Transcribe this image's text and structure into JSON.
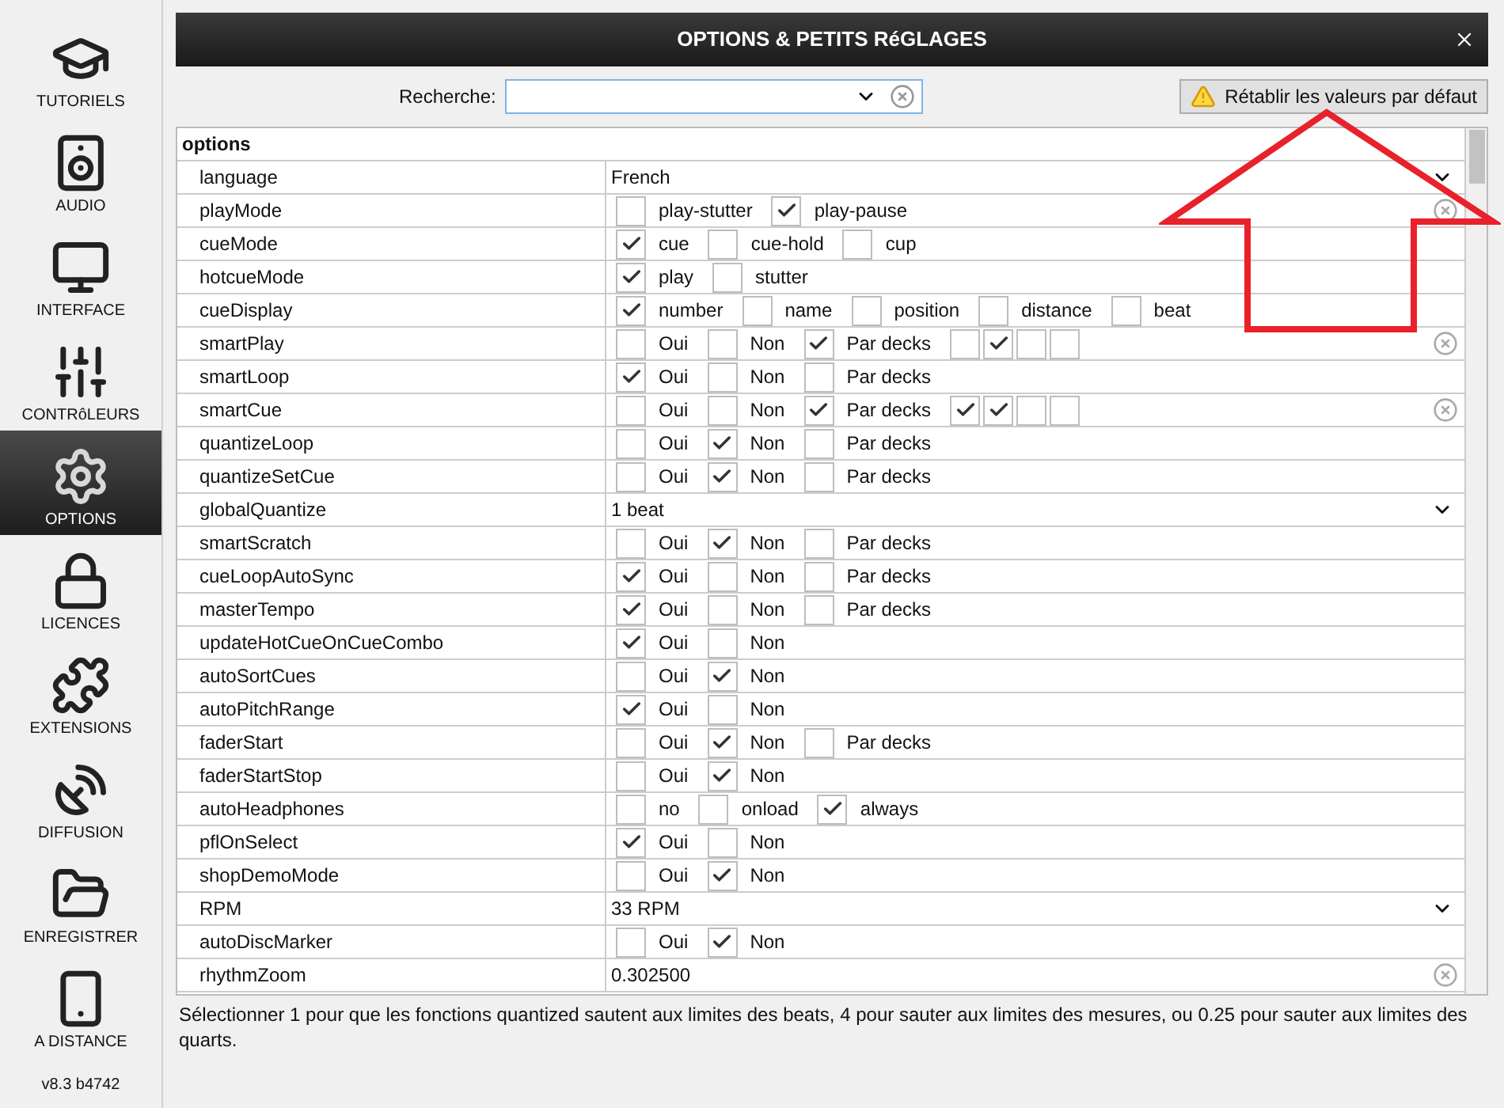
{
  "sidebar": {
    "items": [
      {
        "kind": "tutorials",
        "label": "TUTORIELS",
        "selected": false
      },
      {
        "kind": "audio",
        "label": "AUDIO",
        "selected": false
      },
      {
        "kind": "interface",
        "label": "INTERFACE",
        "selected": false
      },
      {
        "kind": "controllers",
        "label": "CONTRôLEURS",
        "selected": false
      },
      {
        "kind": "options",
        "label": "OPTIONS",
        "selected": true
      },
      {
        "kind": "licences",
        "label": "LICENCES",
        "selected": false
      },
      {
        "kind": "extensions",
        "label": "EXTENSIONS",
        "selected": false
      },
      {
        "kind": "broadcast",
        "label": "DIFFUSION",
        "selected": false
      },
      {
        "kind": "record",
        "label": "ENREGISTRER",
        "selected": false
      },
      {
        "kind": "remote",
        "label": "A DISTANCE",
        "selected": false
      }
    ],
    "version": "v8.3 b4742"
  },
  "window": {
    "title": "OPTIONS & PETITS RéGLAGES"
  },
  "search": {
    "label": "Recherche:"
  },
  "reset_button": {
    "label": "Rétablir les valeurs par défaut"
  },
  "table": {
    "section": "options",
    "rows": [
      {
        "name": "language",
        "kind": "select",
        "value": "French",
        "modified": false
      },
      {
        "name": "playMode",
        "kind": "checks",
        "modified": true,
        "options": [
          {
            "label": "play-stutter",
            "checked": false
          },
          {
            "label": "play-pause",
            "checked": true
          }
        ]
      },
      {
        "name": "cueMode",
        "kind": "checks",
        "modified": false,
        "options": [
          {
            "label": "cue",
            "checked": true
          },
          {
            "label": "cue-hold",
            "checked": false
          },
          {
            "label": "cup",
            "checked": false
          }
        ]
      },
      {
        "name": "hotcueMode",
        "kind": "checks",
        "modified": false,
        "options": [
          {
            "label": "play",
            "checked": true
          },
          {
            "label": "stutter",
            "checked": false
          }
        ]
      },
      {
        "name": "cueDisplay",
        "kind": "checks",
        "modified": false,
        "options": [
          {
            "label": "number",
            "checked": true
          },
          {
            "label": "name",
            "checked": false
          },
          {
            "label": "position",
            "checked": false
          },
          {
            "label": "distance",
            "checked": false
          },
          {
            "label": "beat",
            "checked": false
          }
        ]
      },
      {
        "name": "smartPlay",
        "kind": "checks",
        "modified": true,
        "options": [
          {
            "label": "Oui",
            "checked": false
          },
          {
            "label": "Non",
            "checked": false
          },
          {
            "label": "Par decks",
            "checked": true
          }
        ],
        "decks": [
          {
            "checked": false
          },
          {
            "checked": true
          },
          {
            "checked": false
          },
          {
            "checked": false
          }
        ]
      },
      {
        "name": "smartLoop",
        "kind": "checks",
        "modified": false,
        "options": [
          {
            "label": "Oui",
            "checked": true
          },
          {
            "label": "Non",
            "checked": false
          },
          {
            "label": "Par decks",
            "checked": false
          }
        ]
      },
      {
        "name": "smartCue",
        "kind": "checks",
        "modified": true,
        "options": [
          {
            "label": "Oui",
            "checked": false
          },
          {
            "label": "Non",
            "checked": false
          },
          {
            "label": "Par decks",
            "checked": true
          }
        ],
        "decks": [
          {
            "checked": true
          },
          {
            "checked": true
          },
          {
            "checked": false
          },
          {
            "checked": false
          }
        ]
      },
      {
        "name": "quantizeLoop",
        "kind": "checks",
        "modified": false,
        "options": [
          {
            "label": "Oui",
            "checked": false
          },
          {
            "label": "Non",
            "checked": true
          },
          {
            "label": "Par decks",
            "checked": false
          }
        ]
      },
      {
        "name": "quantizeSetCue",
        "kind": "checks",
        "modified": false,
        "options": [
          {
            "label": "Oui",
            "checked": false
          },
          {
            "label": "Non",
            "checked": true
          },
          {
            "label": "Par decks",
            "checked": false
          }
        ]
      },
      {
        "name": "globalQuantize",
        "kind": "select",
        "value": "1 beat",
        "modified": false
      },
      {
        "name": "smartScratch",
        "kind": "checks",
        "modified": false,
        "options": [
          {
            "label": "Oui",
            "checked": false
          },
          {
            "label": "Non",
            "checked": true
          },
          {
            "label": "Par decks",
            "checked": false
          }
        ]
      },
      {
        "name": "cueLoopAutoSync",
        "kind": "checks",
        "modified": false,
        "options": [
          {
            "label": "Oui",
            "checked": true
          },
          {
            "label": "Non",
            "checked": false
          },
          {
            "label": "Par decks",
            "checked": false
          }
        ]
      },
      {
        "name": "masterTempo",
        "kind": "checks",
        "modified": false,
        "options": [
          {
            "label": "Oui",
            "checked": true
          },
          {
            "label": "Non",
            "checked": false
          },
          {
            "label": "Par decks",
            "checked": false
          }
        ]
      },
      {
        "name": "updateHotCueOnCueCombo",
        "kind": "checks",
        "modified": false,
        "options": [
          {
            "label": "Oui",
            "checked": true
          },
          {
            "label": "Non",
            "checked": false
          }
        ]
      },
      {
        "name": "autoSortCues",
        "kind": "checks",
        "modified": false,
        "options": [
          {
            "label": "Oui",
            "checked": false
          },
          {
            "label": "Non",
            "checked": true
          }
        ]
      },
      {
        "name": "autoPitchRange",
        "kind": "checks",
        "modified": false,
        "options": [
          {
            "label": "Oui",
            "checked": true
          },
          {
            "label": "Non",
            "checked": false
          }
        ]
      },
      {
        "name": "faderStart",
        "kind": "checks",
        "modified": false,
        "options": [
          {
            "label": "Oui",
            "checked": false
          },
          {
            "label": "Non",
            "checked": true
          },
          {
            "label": "Par decks",
            "checked": false
          }
        ]
      },
      {
        "name": "faderStartStop",
        "kind": "checks",
        "modified": false,
        "options": [
          {
            "label": "Oui",
            "checked": false
          },
          {
            "label": "Non",
            "checked": true
          }
        ]
      },
      {
        "name": "autoHeadphones",
        "kind": "checks",
        "modified": false,
        "options": [
          {
            "label": "no",
            "checked": false
          },
          {
            "label": "onload",
            "checked": false
          },
          {
            "label": "always",
            "checked": true
          }
        ]
      },
      {
        "name": "pflOnSelect",
        "kind": "checks",
        "modified": false,
        "options": [
          {
            "label": "Oui",
            "checked": true
          },
          {
            "label": "Non",
            "checked": false
          }
        ]
      },
      {
        "name": "shopDemoMode",
        "kind": "checks",
        "modified": false,
        "options": [
          {
            "label": "Oui",
            "checked": false
          },
          {
            "label": "Non",
            "checked": true
          }
        ]
      },
      {
        "name": "RPM",
        "kind": "select",
        "value": "33 RPM",
        "modified": false
      },
      {
        "name": "autoDiscMarker",
        "kind": "checks",
        "modified": false,
        "options": [
          {
            "label": "Oui",
            "checked": false
          },
          {
            "label": "Non",
            "checked": true
          }
        ]
      },
      {
        "name": "rhythmZoom",
        "kind": "text",
        "value": "0.302500",
        "modified": true
      }
    ]
  },
  "description": "Sélectionner 1 pour que les fonctions quantized sautent aux limites des beats, 4 pour sauter aux limites des mesures, ou 0.25 pour sauter aux limites des quarts."
}
